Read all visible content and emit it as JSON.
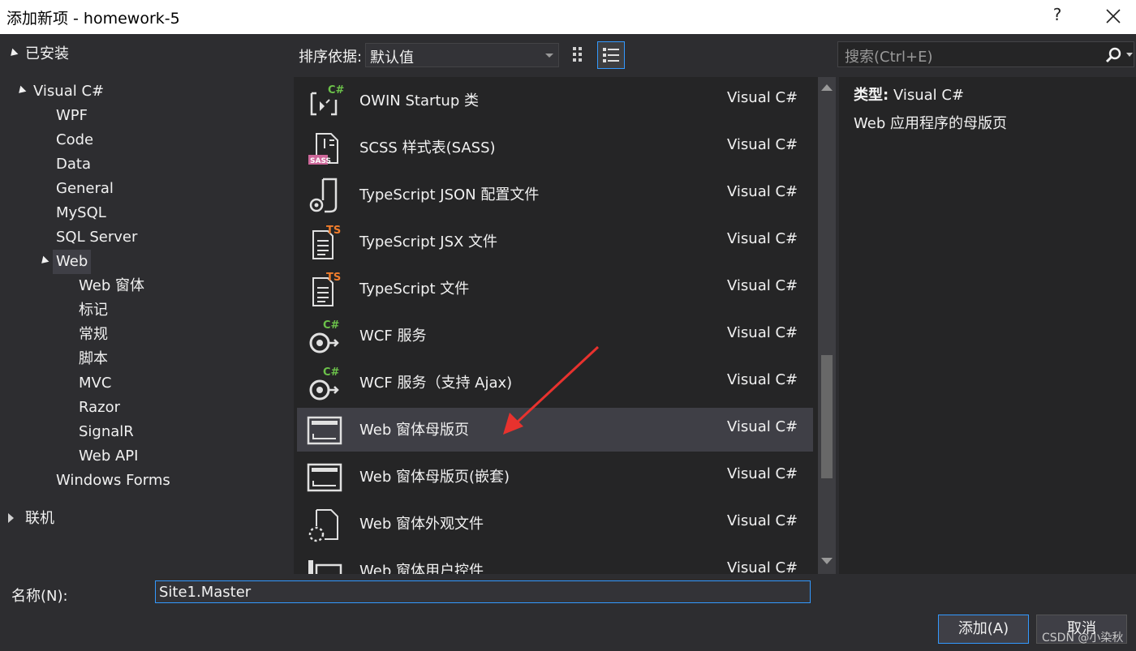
{
  "window": {
    "title": "添加新项 - homework-5",
    "help": "?"
  },
  "tree": {
    "installed": "已安装",
    "visual_csharp": "Visual C#",
    "children": [
      "WPF",
      "Code",
      "Data",
      "General",
      "MySQL",
      "SQL Server"
    ],
    "web": "Web",
    "web_children": [
      "Web 窗体",
      "标记",
      "常规",
      "脚本",
      "MVC",
      "Razor",
      "SignalR",
      "Web API"
    ],
    "windows_forms": "Windows Forms",
    "online": "联机"
  },
  "toolbar": {
    "sort_label": "排序依据:",
    "sort_value": "默认值"
  },
  "search": {
    "placeholder": "搜索(Ctrl+E)"
  },
  "templates": [
    {
      "name": "OWIN Startup 类",
      "lang": "Visual C#",
      "icon": "owin-startup-icon"
    },
    {
      "name": "SCSS 样式表(SASS)",
      "lang": "Visual C#",
      "icon": "scss-file-icon"
    },
    {
      "name": "TypeScript JSON 配置文件",
      "lang": "Visual C#",
      "icon": "typescript-json-config-icon"
    },
    {
      "name": "TypeScript JSX 文件",
      "lang": "Visual C#",
      "icon": "typescript-jsx-file-icon"
    },
    {
      "name": "TypeScript 文件",
      "lang": "Visual C#",
      "icon": "typescript-file-icon"
    },
    {
      "name": "WCF 服务",
      "lang": "Visual C#",
      "icon": "wcf-service-icon"
    },
    {
      "name": "WCF 服务（支持 Ajax)",
      "lang": "Visual C#",
      "icon": "wcf-ajax-service-icon"
    },
    {
      "name": "Web 窗体母版页",
      "lang": "Visual C#",
      "icon": "web-forms-master-page-icon",
      "selected": true
    },
    {
      "name": "Web 窗体母版页(嵌套)",
      "lang": "Visual C#",
      "icon": "web-forms-nested-master-page-icon"
    },
    {
      "name": "Web 窗体外观文件",
      "lang": "Visual C#",
      "icon": "web-forms-skin-file-icon"
    },
    {
      "name": "Web 窗体用户控件",
      "lang": "Visual C#",
      "icon": "web-forms-user-control-icon"
    }
  ],
  "details": {
    "type_label": "类型:",
    "type_value": "Visual C#",
    "description": "Web 应用程序的母版页"
  },
  "bottom": {
    "name_label": "名称(N):",
    "name_value": "Site1.Master",
    "add_button": "添加(A)",
    "cancel_button": "取消",
    "watermark": "CSDN @小染秋"
  },
  "colors": {
    "accent": "#3399ff",
    "arrow": "#e8322e",
    "csharp_badge": "#6cc24a",
    "ts_badge": "#f07d2c",
    "sass_badge": "#cd6799"
  }
}
